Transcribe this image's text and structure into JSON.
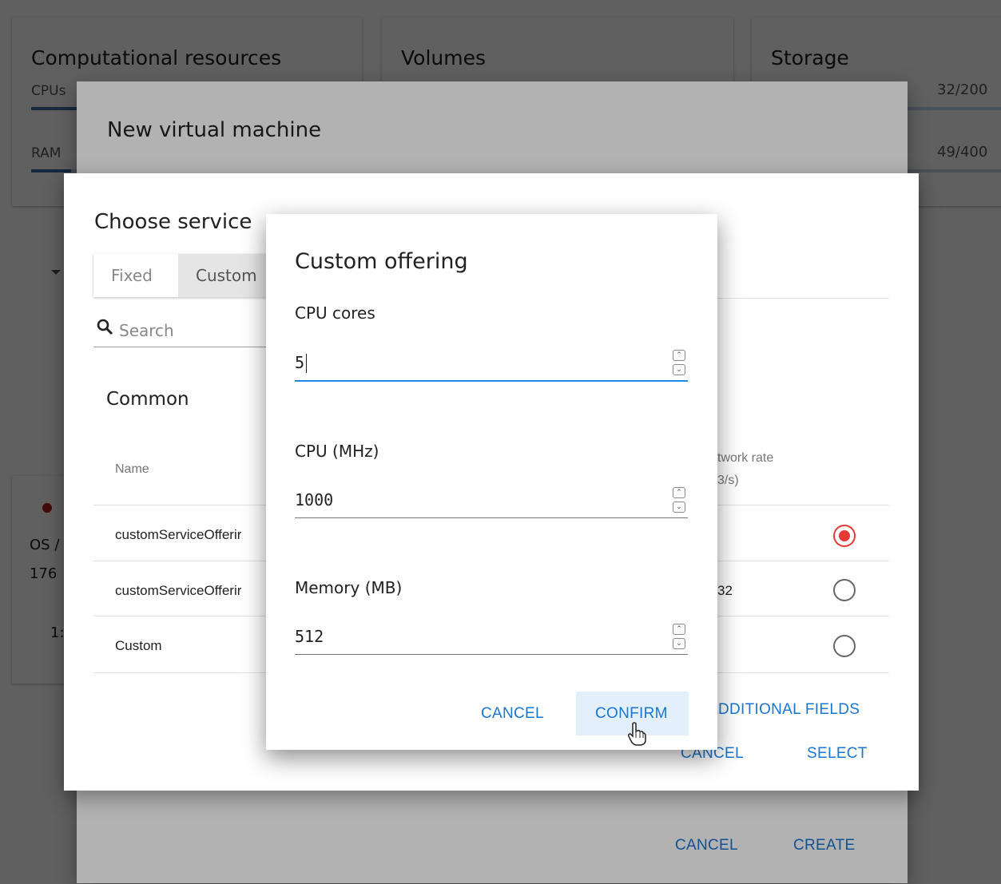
{
  "resources": {
    "cards": [
      {
        "title": "Computational resources"
      },
      {
        "title": "Volumes"
      },
      {
        "title": "Storage"
      }
    ],
    "rows": [
      {
        "label": "CPUs",
        "value": "32/200",
        "fraction": 0.16
      },
      {
        "label": "RAM",
        "value": "49/400",
        "fraction": 0.1225
      }
    ]
  },
  "background_item": {
    "os_prefix": "OS /",
    "number_prefix": "176",
    "number2": "1:"
  },
  "vm_dialog": {
    "title": "New virtual machine",
    "cancel": "CANCEL",
    "create": "CREATE"
  },
  "service_dialog": {
    "title": "Choose service",
    "tabs": [
      "Fixed",
      "Custom"
    ],
    "search_placeholder": "Search",
    "group": "Common",
    "header_name": "Name",
    "header_network_1": "twork rate",
    "header_network_2": "3/s)",
    "rows": [
      {
        "name": "customServiceOfferir",
        "extra": "",
        "selected": true
      },
      {
        "name": "customServiceOfferir",
        "extra": "32",
        "selected": false
      },
      {
        "name": "Custom",
        "extra": "",
        "selected": false
      }
    ],
    "additional_fields": "ADDITIONAL FIELDS",
    "cancel": "CANCEL",
    "select": "SELECT"
  },
  "custom_offering": {
    "title": "Custom offering",
    "fields": [
      {
        "label": "CPU cores",
        "value": "5"
      },
      {
        "label": "CPU (MHz)",
        "value": "1000"
      },
      {
        "label": "Memory (MB)",
        "value": "512"
      }
    ],
    "cancel": "CANCEL",
    "confirm": "CONFIRM"
  },
  "colors": {
    "accent": "#1976d2",
    "focus_underline": "#1e88e5",
    "radio_selected": "#e53935",
    "status_dot": "#b71c1c"
  }
}
